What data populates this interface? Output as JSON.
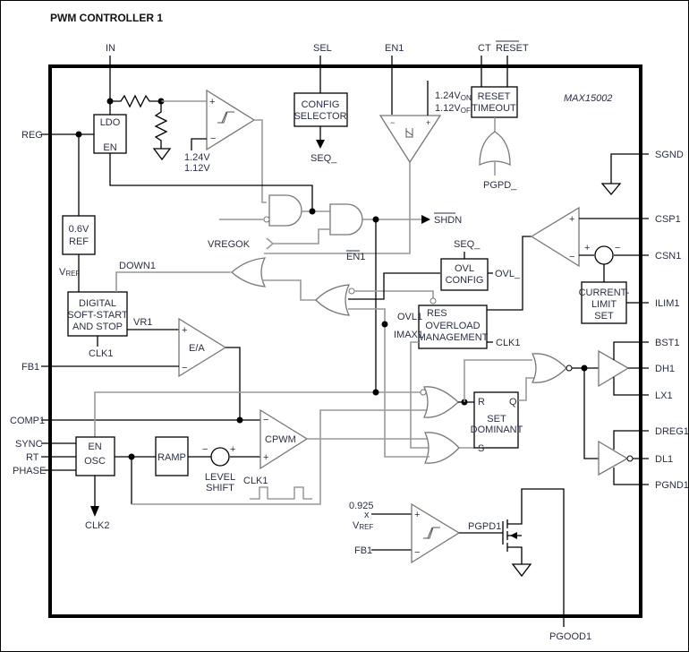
{
  "title": "PWM CONTROLLER 1",
  "chip_name": "MAX15002",
  "pins_top": {
    "in": "IN",
    "sel": "SEL",
    "en1": "EN1",
    "ct": "CT",
    "reset": "RESET"
  },
  "pins_left": {
    "reg": "REG",
    "fb1": "FB1",
    "comp1": "COMP1",
    "sync": "SYNC",
    "rt": "RT",
    "phase": "PHASE"
  },
  "pins_right": {
    "sgnd": "SGND",
    "csp1": "CSP1",
    "csn1": "CSN1",
    "ilim1": "ILIM1",
    "bst1": "BST1",
    "dh1": "DH1",
    "lx1": "LX1",
    "dreg1": "DREG1",
    "dl1": "DL1",
    "pgnd1": "PGND1"
  },
  "pins_bottom": {
    "pgood1": "PGOOD1"
  },
  "blocks": {
    "ldo": {
      "line1": "LDO",
      "line2": "EN"
    },
    "config_selector": {
      "line1": "CONFIG",
      "line2": "SELECTOR"
    },
    "reset_timeout": {
      "line1": "RESET",
      "line2": "TIMEOUT"
    },
    "ref": {
      "line1": "0.6V",
      "line2": "REF"
    },
    "soft_start": {
      "line1": "DIGITAL",
      "line2": "SOFT-START",
      "line3": "AND STOP"
    },
    "ovl_config": {
      "line1": "OVL",
      "line2": "CONFIG"
    },
    "overload": {
      "res": "RES",
      "line1": "OVERLOAD",
      "line2": "MANAGEMENT"
    },
    "current_limit": {
      "line1": "CURRENT-",
      "line2": "LIMIT",
      "line3": "SET"
    },
    "osc": {
      "line1": "EN",
      "line2": "OSC"
    },
    "ramp": {
      "label": "RAMP"
    },
    "flipflop": {
      "r": "R",
      "q": "Q",
      "s": "S",
      "line1": "SET",
      "line2": "DOMINANT"
    }
  },
  "labels": {
    "seq_out": "SEQ_",
    "v124": "1.24V",
    "v112": "1.12V",
    "v124on": "1.24V",
    "on_sub": "ON",
    "v112off": "1.12V",
    "off_sub": "OFF",
    "pgpd_": "PGPD_",
    "shdn": "SHDN",
    "vregok": "VREGOK",
    "en1_bar": "EN1",
    "seq_in": "SEQ_",
    "ovl_": "OVL_",
    "down1": "DOWN1",
    "vref": "V",
    "vref_sub": "REF",
    "vr1": "VR1",
    "ea": "E/A",
    "clk1_ss": "CLK1",
    "ovl1": "OVL1",
    "imax1": "IMAX1",
    "clk1_ovl": "CLK1",
    "cpwm": "CPWM",
    "level_shift_1": "LEVEL",
    "level_shift_2": "SHIFT",
    "clk1_wave": "CLK1",
    "clk2": "CLK2",
    "k0925": "0.925",
    "x": "x",
    "vref2": "V",
    "vref2_sub": "REF",
    "fb1_pg": "FB1",
    "pgpd1": "PGPD1",
    "plus": "+",
    "minus": "−"
  }
}
